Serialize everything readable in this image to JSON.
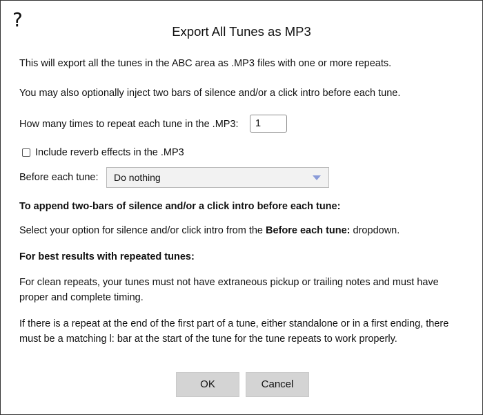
{
  "dialog": {
    "help_glyph": "?",
    "title": "Export All Tunes as MP3"
  },
  "intro": {
    "line1": "This will export all the tunes in the ABC area as .MP3 files with one or more repeats.",
    "line2": "You may also optionally inject two bars of silence and/or a click intro before each tune."
  },
  "repeat": {
    "label": "How many times to repeat each tune in the .MP3:",
    "value": "1"
  },
  "reverb": {
    "label": "Include reverb effects in the .MP3",
    "checked": false
  },
  "before_tune": {
    "label": "Before each tune:",
    "selected": "Do nothing"
  },
  "help_text": {
    "heading1": "To append two-bars of silence and/or a click intro before each tune:",
    "para1_before": "Select your option for silence and/or click intro from the ",
    "para1_bold": "Before each tune:",
    "para1_after": " dropdown.",
    "heading2": "For best results with repeated tunes:",
    "para2_line1": "For clean repeats, your tunes must not have extraneous pickup or trailing notes and must have",
    "para2_line2": "proper and complete timing.",
    "para3_line1": "If there is a repeat at the end of the first part of a tune, either standalone or in a first ending, there",
    "para3_line2": "must be a matching l: bar at the start of the tune for the tune repeats to work properly."
  },
  "buttons": {
    "ok": "OK",
    "cancel": "Cancel"
  },
  "colors": {
    "button_bg": "#d4d4d4",
    "select_bg": "#f2f2f2",
    "dropdown_arrow": "#8a9bd8"
  }
}
